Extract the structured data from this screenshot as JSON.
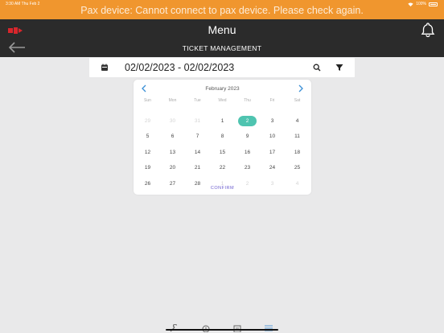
{
  "status_bar": {
    "time": "3:30 AM",
    "date": "Thu Feb 2",
    "battery": "100%"
  },
  "alert": {
    "text": "Pax device: Cannot connect to pax device. Please check again."
  },
  "header": {
    "title": "Menu",
    "subtitle": "TICKET MANAGEMENT"
  },
  "date_filter": {
    "range": "02/02/2023 - 02/02/2023"
  },
  "calendar": {
    "month_label": "February 2023",
    "weekdays": [
      "Sun",
      "Mon",
      "Tue",
      "Wed",
      "Thu",
      "Fri",
      "Sat"
    ],
    "weeks": [
      [
        {
          "d": "29",
          "m": true
        },
        {
          "d": "30",
          "m": true
        },
        {
          "d": "31",
          "m": true
        },
        {
          "d": "1"
        },
        {
          "d": "2",
          "s": true
        },
        {
          "d": "3"
        },
        {
          "d": "4"
        }
      ],
      [
        {
          "d": "5"
        },
        {
          "d": "6"
        },
        {
          "d": "7"
        },
        {
          "d": "8"
        },
        {
          "d": "9"
        },
        {
          "d": "10"
        },
        {
          "d": "11"
        }
      ],
      [
        {
          "d": "12"
        },
        {
          "d": "13"
        },
        {
          "d": "14"
        },
        {
          "d": "15"
        },
        {
          "d": "16"
        },
        {
          "d": "17"
        },
        {
          "d": "18"
        }
      ],
      [
        {
          "d": "19"
        },
        {
          "d": "20"
        },
        {
          "d": "21"
        },
        {
          "d": "22"
        },
        {
          "d": "23"
        },
        {
          "d": "24"
        },
        {
          "d": "25"
        }
      ],
      [
        {
          "d": "26"
        },
        {
          "d": "27"
        },
        {
          "d": "28"
        },
        {
          "d": "1",
          "m": true
        },
        {
          "d": "2",
          "m": true
        },
        {
          "d": "3",
          "m": true
        },
        {
          "d": "4",
          "m": true
        }
      ]
    ],
    "confirm_label": "CONFIRM"
  },
  "colors": {
    "alert": "#f0962e",
    "header": "#2b2b2b",
    "selected": "#4fc4b0",
    "confirm": "#6c5ecf"
  }
}
